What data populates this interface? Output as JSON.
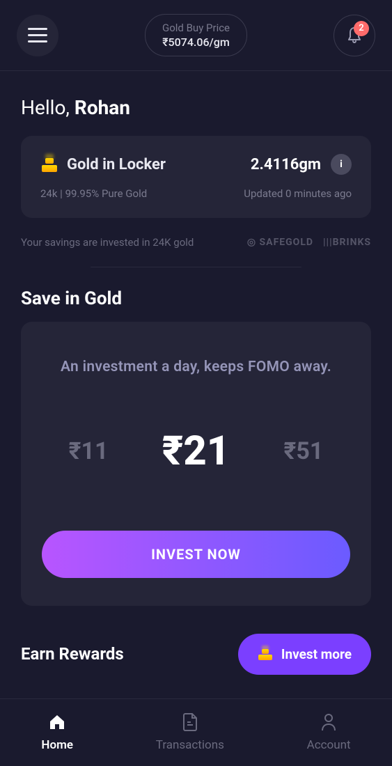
{
  "header": {
    "price_label": "Gold Buy Price",
    "price_value": "₹5074.06/gm",
    "notif_count": "2"
  },
  "greeting": {
    "prefix": "Hello, ",
    "name": "Rohan"
  },
  "locker": {
    "title": "Gold in Locker",
    "amount": "2.4116gm",
    "purity": "24k | 99.95% Pure Gold",
    "updated": "Updated 0 minutes ago"
  },
  "savings": {
    "text": "Your savings are invested in 24K gold",
    "brand1": "◎ SAFEGOLD",
    "brand2": "|||BRINKS"
  },
  "save_section": {
    "title": "Save in Gold",
    "tagline": "An investment a day, keeps FOMO away.",
    "amounts": [
      "₹11",
      "₹21",
      "₹51"
    ],
    "button": "INVEST NOW"
  },
  "rewards": {
    "title": "Earn Rewards",
    "button": "Invest more"
  },
  "nav": [
    {
      "label": "Home",
      "active": true
    },
    {
      "label": "Transactions",
      "active": false
    },
    {
      "label": "Account",
      "active": false
    }
  ]
}
